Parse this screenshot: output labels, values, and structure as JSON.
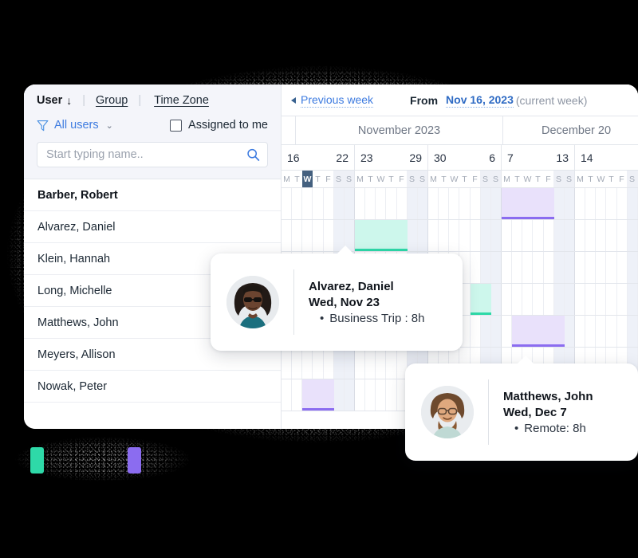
{
  "left_panel": {
    "tabs": {
      "user_label": "User",
      "sort_arrow": "↓",
      "divider": "|",
      "group_label": "Group",
      "timezone_label": "Time Zone"
    },
    "filter": {
      "icon": "funnel-icon",
      "label": "All users",
      "chevron": "⌄"
    },
    "assigned_to_me": {
      "label": "Assigned to me",
      "checked": false
    },
    "search": {
      "placeholder": "Start typing name..",
      "value": "",
      "icon": "search-icon"
    },
    "users": [
      {
        "name": "Barber, Robert",
        "bold": true
      },
      {
        "name": "Alvarez, Daniel",
        "bold": false
      },
      {
        "name": "Klein, Hannah",
        "bold": false
      },
      {
        "name": "Long, Michelle",
        "bold": false
      },
      {
        "name": "Matthews, John",
        "bold": false
      },
      {
        "name": "Meyers, Allison",
        "bold": false
      },
      {
        "name": "Nowak, Peter",
        "bold": false
      }
    ]
  },
  "calendar": {
    "header": {
      "prev_week_label": "Previous week",
      "prev_week_icon": "triangle-left-icon",
      "from_label": "From",
      "from_date": "Nov 16, 2023",
      "current_week_note": "(current week)"
    },
    "months": [
      {
        "label": "November 2023"
      },
      {
        "label": "December 20"
      }
    ],
    "weeks": [
      {
        "start": "16",
        "end": "22"
      },
      {
        "start": "23",
        "end": "29"
      },
      {
        "start": "30",
        "end": "6"
      },
      {
        "start": "7",
        "end": "13"
      },
      {
        "start": "14",
        "end": ""
      }
    ],
    "day_letters": [
      "M",
      "T",
      "W",
      "T",
      "F",
      "S",
      "S"
    ],
    "today": {
      "week_index": 0,
      "day_index": 2,
      "letter": "W"
    },
    "weekend_indices": [
      5,
      6
    ],
    "row_count": 7
  },
  "events": [
    {
      "user": "Alvarez, Daniel",
      "label": "Business Trip",
      "color": "#2ed9a8",
      "fill": "#cdf7ec"
    },
    {
      "user": "Matthews, John",
      "label": "Remote",
      "color": "#8b6cf0",
      "fill": "#e9e1fb"
    }
  ],
  "tooltips": [
    {
      "name": "Alvarez, Daniel",
      "date": "Wed, Nov 23",
      "bullet": "•",
      "entry": "Business Trip  : 8h",
      "avatar": "avatar-alvarez"
    },
    {
      "name": "Matthews, John",
      "date": "Wed, Dec 7",
      "bullet": "•",
      "entry": "Remote: 8h",
      "avatar": "avatar-matthews"
    }
  ],
  "legend": {
    "chips": [
      {
        "name": "business-trip",
        "color": "#2ed9a8"
      },
      {
        "name": "remote",
        "color": "#8b6cf0"
      }
    ]
  }
}
